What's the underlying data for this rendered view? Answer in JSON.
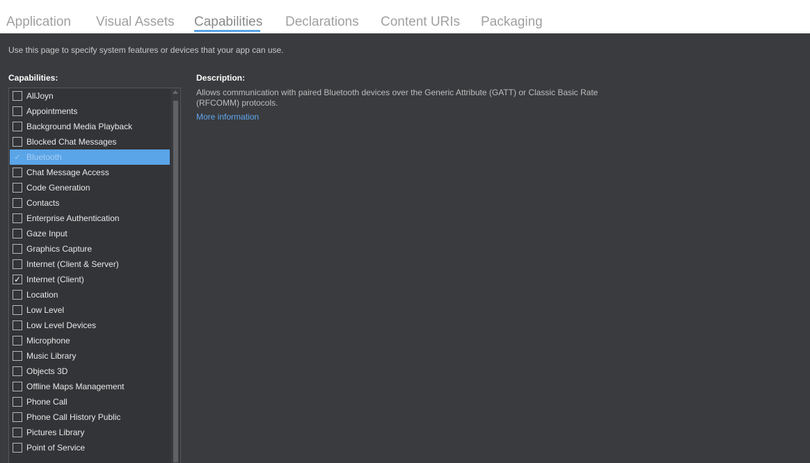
{
  "tabs": [
    {
      "label": "Application"
    },
    {
      "label": "Visual Assets"
    },
    {
      "label": "Capabilities"
    },
    {
      "label": "Declarations"
    },
    {
      "label": "Content URIs"
    },
    {
      "label": "Packaging"
    }
  ],
  "active_tab": "Capabilities",
  "intro": "Use this page to specify system features or devices that your app can use.",
  "capabilities_header": "Capabilities:",
  "description_header": "Description:",
  "description_text": "Allows communication with paired Bluetooth devices over the Generic Attribute (GATT) or Classic Basic Rate (RFCOMM) protocols.",
  "more_info": "More information",
  "check_glyph": "✓",
  "colors": {
    "background": "#3a3b3e",
    "accent": "#5aa4e8",
    "link": "#5fa8f0"
  },
  "capabilities": [
    {
      "label": "AllJoyn",
      "checked": false
    },
    {
      "label": "Appointments",
      "checked": false
    },
    {
      "label": "Background Media Playback",
      "checked": false
    },
    {
      "label": "Blocked Chat Messages",
      "checked": false
    },
    {
      "label": "Bluetooth",
      "checked": true,
      "selected": true
    },
    {
      "label": "Chat Message Access",
      "checked": false
    },
    {
      "label": "Code Generation",
      "checked": false
    },
    {
      "label": "Contacts",
      "checked": false
    },
    {
      "label": "Enterprise Authentication",
      "checked": false
    },
    {
      "label": "Gaze Input",
      "checked": false
    },
    {
      "label": "Graphics Capture",
      "checked": false
    },
    {
      "label": "Internet (Client & Server)",
      "checked": false
    },
    {
      "label": "Internet (Client)",
      "checked": true
    },
    {
      "label": "Location",
      "checked": false
    },
    {
      "label": "Low Level",
      "checked": false
    },
    {
      "label": "Low Level Devices",
      "checked": false
    },
    {
      "label": "Microphone",
      "checked": false
    },
    {
      "label": "Music Library",
      "checked": false
    },
    {
      "label": "Objects 3D",
      "checked": false
    },
    {
      "label": "Offline Maps Management",
      "checked": false
    },
    {
      "label": "Phone Call",
      "checked": false
    },
    {
      "label": "Phone Call History Public",
      "checked": false
    },
    {
      "label": "Pictures Library",
      "checked": false
    },
    {
      "label": "Point of Service",
      "checked": false
    }
  ]
}
